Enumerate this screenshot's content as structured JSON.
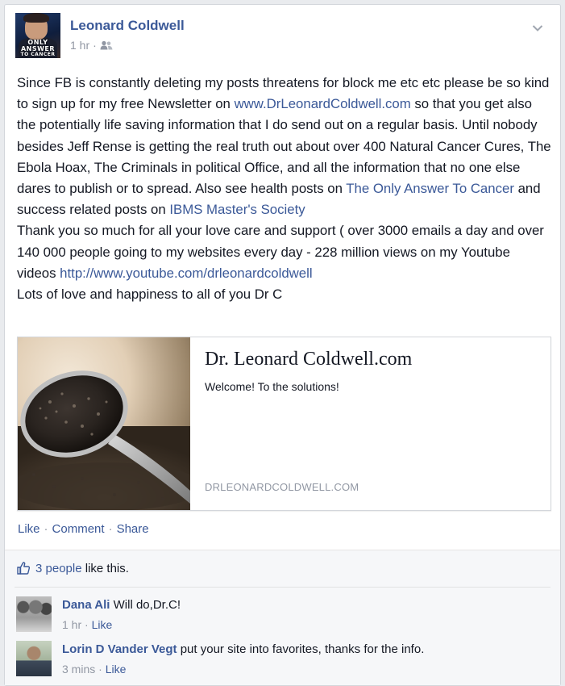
{
  "post": {
    "author": "Leonard Coldwell",
    "avatar_text_line1": "ONLY",
    "avatar_text_line2": "ANSWER",
    "avatar_text_line3": "TO CANCER",
    "time": "1 hr",
    "meta_sep": "·",
    "privacy_icon": "friends-icon",
    "menu_icon": "chevron-down-icon",
    "text": {
      "p1_a": "Since FB is constantly deleting my posts threatens for block me etc etc please be so kind to sign up for my free Newsletter on ",
      "p1_link": "www.DrLeonardColdwell.com",
      "p1_b": " so that you get also the potentially life saving information that I do send out on a regular basis. Until nobody besides Jeff Rense is getting the real truth out about over 400 Natural Cancer Cures, The Ebola Hoax, The Criminals in political Office, and all the information that no one else dares to publish or to spread. Also see health posts on ",
      "p1_link2": "The Only Answer To Cancer",
      "p1_c": " and success related posts on ",
      "p1_link3": "IBMS Master's Society",
      "p2_a": "Thank you so much for all your love care and support ( over 3000 emails a day and over 140 000 people going to my websites every day - 228 million views on my Youtube videos ",
      "p2_link": "http://www.youtube.com/drleonardcoldwell",
      "p3": "Lots of love and happiness to all of you Dr C"
    },
    "link_preview": {
      "title": "Dr. Leonard Coldwell.com",
      "subtitle": "Welcome! To the solutions!",
      "domain": "DRLEONARDCOLDWELL.COM"
    },
    "actions": {
      "like": "Like",
      "comment": "Comment",
      "share": "Share",
      "sep": "·"
    }
  },
  "feedback": {
    "likes_icon": "thumbs-up-icon",
    "likes_link": "3 people",
    "likes_rest": "like this.",
    "comments": [
      {
        "name": "Dana Ali",
        "text": "Will do,Dr.C!",
        "time": "1 hr",
        "like": "Like"
      },
      {
        "name": "Lorin D Vander Vegt",
        "text": "put your site into favorites, thanks for the info.",
        "time": "3 mins",
        "like": "Like"
      }
    ]
  },
  "colors": {
    "link_blue": "#3b5998",
    "meta_gray": "#9197a3",
    "text": "#141823"
  }
}
